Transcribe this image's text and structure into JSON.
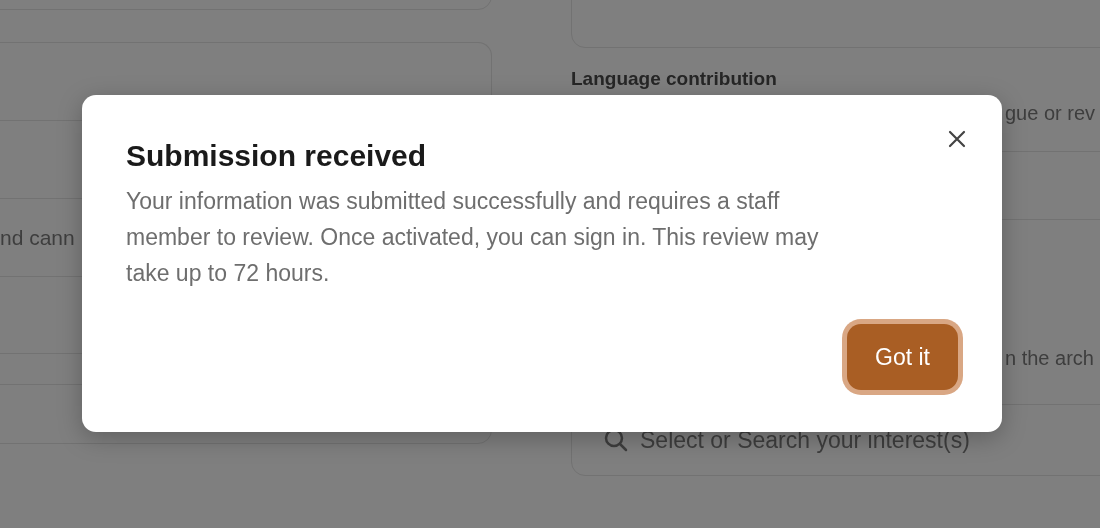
{
  "form": {
    "left_fragment": "nd cann",
    "right_label": "Language contribution",
    "right_fragment_1": "gue or rev",
    "right_fragment_2": "n the arch",
    "search": {
      "placeholder": "Select or Search your interest(s)"
    }
  },
  "dialog": {
    "title": "Submission received",
    "message": "Your information was submitted successfully and requires a staff member to review. Once activated, you can sign in. This review may take up to 72 hours.",
    "button": "Got it"
  }
}
